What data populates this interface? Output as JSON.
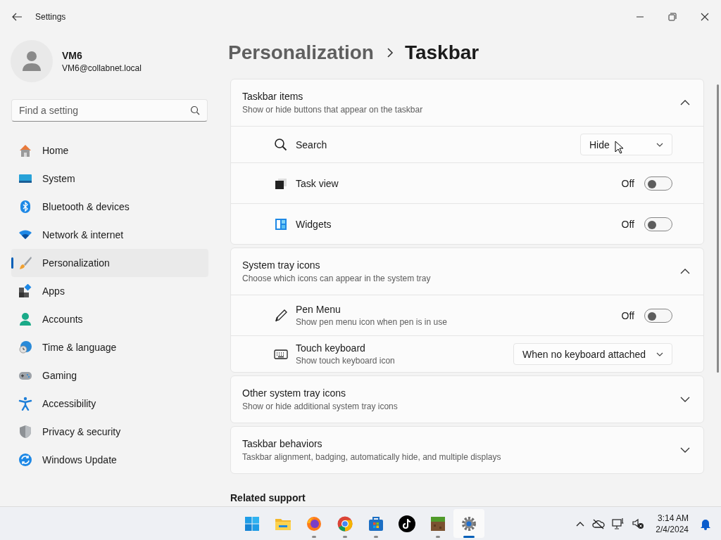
{
  "window": {
    "title": "Settings"
  },
  "user": {
    "name": "VM6",
    "email": "VM6@collabnet.local"
  },
  "search": {
    "placeholder": "Find a setting"
  },
  "sidebar": {
    "items": [
      {
        "label": "Home",
        "selected": false
      },
      {
        "label": "System",
        "selected": false
      },
      {
        "label": "Bluetooth & devices",
        "selected": false
      },
      {
        "label": "Network & internet",
        "selected": false
      },
      {
        "label": "Personalization",
        "selected": true
      },
      {
        "label": "Apps",
        "selected": false
      },
      {
        "label": "Accounts",
        "selected": false
      },
      {
        "label": "Time & language",
        "selected": false
      },
      {
        "label": "Gaming",
        "selected": false
      },
      {
        "label": "Accessibility",
        "selected": false
      },
      {
        "label": "Privacy & security",
        "selected": false
      },
      {
        "label": "Windows Update",
        "selected": false
      }
    ]
  },
  "breadcrumb": [
    {
      "label": "Personalization"
    },
    {
      "label": "Taskbar"
    }
  ],
  "sections": [
    {
      "title": "Taskbar items",
      "subtitle": "Show or hide buttons that appear on the taskbar",
      "expanded": true,
      "rows": [
        {
          "kind": "dropdown",
          "label": "Search",
          "value": "Hide"
        },
        {
          "kind": "toggle",
          "label": "Task view",
          "on": false,
          "state_label": "Off"
        },
        {
          "kind": "toggle",
          "label": "Widgets",
          "on": false,
          "state_label": "Off"
        }
      ]
    },
    {
      "title": "System tray icons",
      "subtitle": "Choose which icons can appear in the system tray",
      "expanded": true,
      "rows": [
        {
          "kind": "toggle",
          "label": "Pen Menu",
          "description": "Show pen menu icon when pen is in use",
          "on": false,
          "state_label": "Off"
        },
        {
          "kind": "dropdown",
          "label": "Touch keyboard",
          "description": "Show touch keyboard icon",
          "value": "When no keyboard attached"
        }
      ]
    },
    {
      "title": "Other system tray icons",
      "subtitle": "Show or hide additional system tray icons",
      "expanded": false
    },
    {
      "title": "Taskbar behaviors",
      "subtitle": "Taskbar alignment, badging, automatically hide, and multiple displays",
      "expanded": false
    }
  ],
  "related_support": {
    "title": "Related support"
  },
  "taskbar": {
    "apps": [
      {
        "running": false,
        "active": false
      },
      {
        "running": false,
        "active": false
      },
      {
        "running": true,
        "active": false
      },
      {
        "running": true,
        "active": false
      },
      {
        "running": true,
        "active": false
      },
      {
        "running": false,
        "active": false
      },
      {
        "running": true,
        "active": false
      },
      {
        "running": true,
        "active": true
      }
    ],
    "clock": {
      "time": "3:14 AM",
      "date": "2/4/2024"
    }
  }
}
